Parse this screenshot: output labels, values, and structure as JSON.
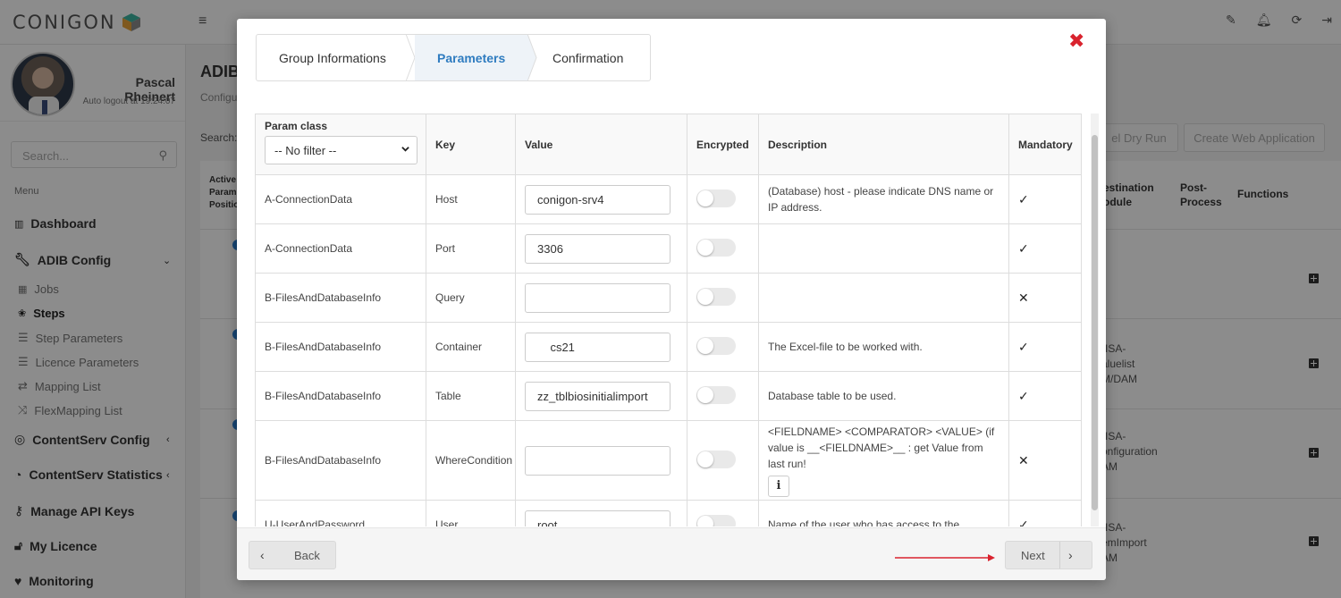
{
  "app": {
    "logo_text": "CONIGON",
    "user_name": "Pascal Rheinert",
    "auto_logout": "Auto logout at 19:24:07",
    "search_placeholder": "Search...",
    "menu_label": "Menu",
    "nav": {
      "dashboard": "Dashboard",
      "adib_config": "ADIB Config",
      "jobs": "Jobs",
      "steps": "Steps",
      "step_parameters": "Step Parameters",
      "licence_parameters": "Licence Parameters",
      "mapping_list": "Mapping List",
      "flexmapping_list": "FlexMapping List",
      "contentserv_config": "ContentServ Config",
      "contentserv_statistics": "ContentServ Statistics",
      "manage_api_keys": "Manage API Keys",
      "my_licence": "My Licence",
      "monitoring": "Monitoring"
    },
    "page_title": "ADIB",
    "page_sub": "Configu",
    "search_label": "Search:",
    "btn_dry_run": "el Dry Run",
    "btn_create_web": "Create Web Application",
    "table": {
      "col_active": [
        "Active",
        "Param",
        "Positio"
      ],
      "col_destination": [
        "estination",
        "odule"
      ],
      "col_post": [
        "Post-",
        "Process"
      ],
      "col_functions": "Functions",
      "row2_dest": [
        "-ISA-",
        "aluelist",
        "M/DAM"
      ],
      "row3_dest": [
        "-ISA-",
        "onfiguration",
        "AM"
      ],
      "row4_dest": [
        "-ISA-",
        "emImport",
        "AM"
      ]
    }
  },
  "modal": {
    "steps": [
      "Group Informations",
      "Parameters",
      "Confirmation"
    ],
    "active_step": "Parameters",
    "columns": {
      "param_class": "Param class",
      "key": "Key",
      "value": "Value",
      "encrypted": "Encrypted",
      "description": "Description",
      "mandatory": "Mandatory"
    },
    "filter": {
      "selected": "-- No filter --"
    },
    "rows": [
      {
        "param_class": "A-ConnectionData",
        "key": "Host",
        "value": "conigon-srv4",
        "encrypted": false,
        "description": "(Database) host - please indicate DNS name or IP address.",
        "mandatory": "✓"
      },
      {
        "param_class": "A-ConnectionData",
        "key": "Port",
        "value": "3306",
        "encrypted": false,
        "description": "",
        "mandatory": "✓"
      },
      {
        "param_class": "B-FilesAndDatabaseInfo",
        "key": "Query",
        "value": "",
        "encrypted": false,
        "description": "",
        "mandatory": "✕"
      },
      {
        "param_class": "B-FilesAndDatabaseInfo",
        "key": "Container",
        "value": "    cs21",
        "encrypted": false,
        "description": "The Excel-file to be worked with.",
        "mandatory": "✓"
      },
      {
        "param_class": "B-FilesAndDatabaseInfo",
        "key": "Table",
        "value": "zz_tblbiosinitialimport",
        "encrypted": false,
        "description": "Database table to be used.",
        "mandatory": "✓"
      },
      {
        "param_class": "B-FilesAndDatabaseInfo",
        "key": "WhereCondition",
        "value": "",
        "encrypted": false,
        "description": "<FIELDNAME> <COMPARATOR> <VALUE> (if value is __<FIELDNAME>__ : get Value from last run!",
        "mandatory": "✕"
      },
      {
        "param_class": "U-UserAndPassword",
        "key": "User",
        "value": "root",
        "encrypted": false,
        "description": "Name of the user who has access to the",
        "mandatory": "✓"
      }
    ],
    "footer": {
      "back": "Back",
      "next": "Next"
    }
  },
  "colors": {
    "accent": "#2f7cc0",
    "close": "#d9232e",
    "arrow": "#d9232e"
  }
}
